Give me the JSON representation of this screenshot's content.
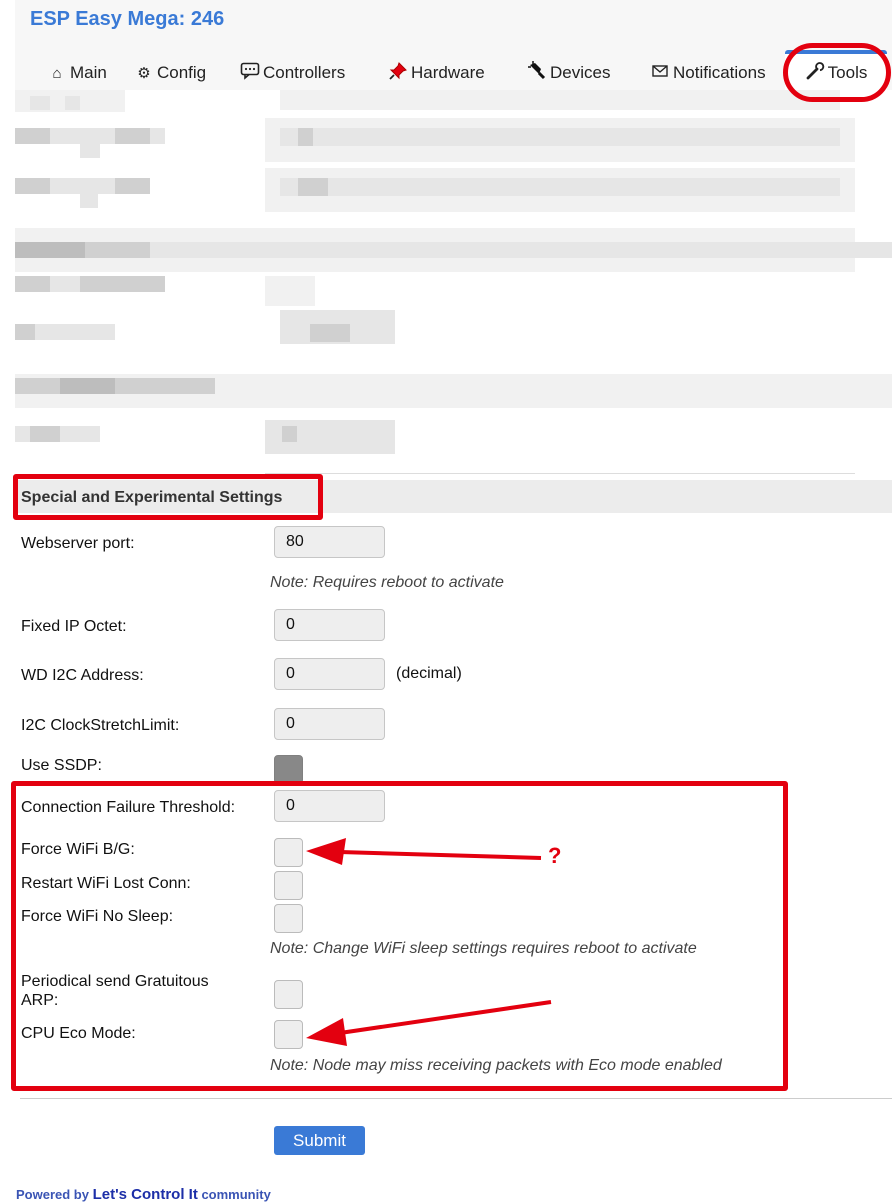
{
  "app": {
    "title": "ESP Easy Mega: 246"
  },
  "tabs": [
    {
      "label": "Main",
      "icon": "home-icon"
    },
    {
      "label": "Config",
      "icon": "gear-icon"
    },
    {
      "label": "Controllers",
      "icon": "chat-bubble-icon"
    },
    {
      "label": "Hardware",
      "icon": "pushpin-icon"
    },
    {
      "label": "Devices",
      "icon": "plug-icon"
    },
    {
      "label": "Notifications",
      "icon": "envelope-icon"
    },
    {
      "label": "Tools",
      "icon": "wrench-icon",
      "active": true
    }
  ],
  "section": {
    "title": "Special and Experimental Settings"
  },
  "fields": {
    "webserver_port": {
      "label": "Webserver port:",
      "value": "80"
    },
    "webserver_note": "Note: Requires reboot to activate",
    "fixed_ip": {
      "label": "Fixed IP Octet:",
      "value": "0"
    },
    "wd_i2c": {
      "label": "WD I2C Address:",
      "value": "0",
      "suffix": "(decimal)"
    },
    "i2c_clock": {
      "label": "I2C ClockStretchLimit:",
      "value": "0"
    },
    "use_ssdp": {
      "label": "Use SSDP:",
      "checked": true
    },
    "conn_fail": {
      "label": "Connection Failure Threshold:",
      "value": "0"
    },
    "force_bg": {
      "label": "Force WiFi B/G:",
      "checked": false
    },
    "restart_wifi": {
      "label": "Restart WiFi Lost Conn:",
      "checked": false
    },
    "no_sleep": {
      "label": "Force WiFi No Sleep:",
      "checked": false
    },
    "sleep_note": "Note: Change WiFi sleep settings requires reboot to activate",
    "garp": {
      "label_line1": "Periodical send Gratuitous",
      "label_line2": "ARP:",
      "checked": false
    },
    "eco": {
      "label": "CPU Eco Mode:",
      "checked": false
    },
    "eco_note": "Note: Node may miss receiving packets with Eco mode enabled"
  },
  "submit_label": "Submit",
  "footer": {
    "prefix": "Powered by",
    "link": "Let's Control It",
    "suffix": "community"
  },
  "annotation": {
    "question_mark": "?"
  },
  "colors": {
    "accent": "#3a7ad6",
    "annotation_red": "#e3000f"
  }
}
